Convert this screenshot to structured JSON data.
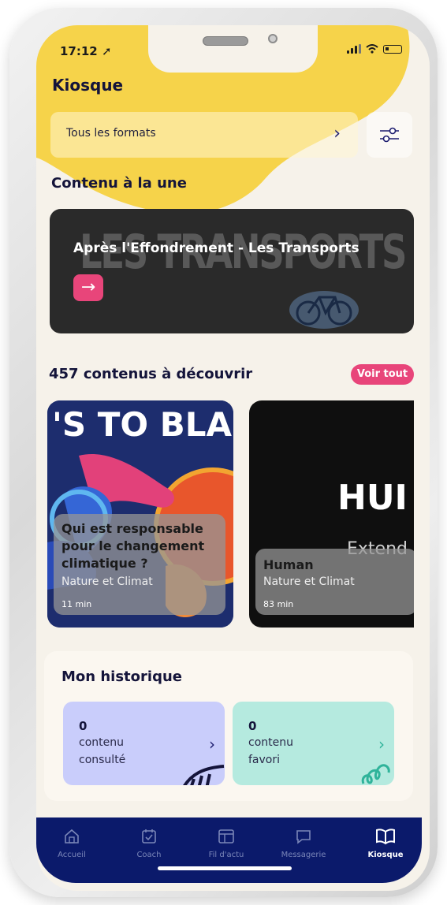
{
  "status_bar": {
    "time": "17:12"
  },
  "header": {
    "title": "Kiosque"
  },
  "format_filter": {
    "label": "Tous les formats"
  },
  "featured": {
    "section_title": "Contenu à la une",
    "card_background_text": "LES TRANSPORTS",
    "card_title": "Après l'Effondrement - Les Transports"
  },
  "discover": {
    "section_title": "457 contenus à découvrir",
    "see_all_label": "Voir tout",
    "cards": [
      {
        "image_text": "'S TO BLA",
        "title_lines": [
          "Qui est responsable",
          "pour le changement",
          "climatique ?"
        ],
        "category": "Nature et Climat",
        "duration": "11 min"
      },
      {
        "image_text": "HUI",
        "image_subtext": "Extend",
        "title_lines": [
          "Human"
        ],
        "category": "Nature et Climat",
        "duration": "83 min"
      }
    ]
  },
  "history": {
    "title": "Mon historique",
    "viewed": {
      "count": "0",
      "line1": "contenu",
      "line2": "consulté"
    },
    "favorites": {
      "count": "0",
      "line1": "contenu",
      "line2": "favori"
    }
  },
  "tab_bar": {
    "items": [
      {
        "label": "Accueil",
        "icon": "home-icon"
      },
      {
        "label": "Coach",
        "icon": "calendar-check-icon"
      },
      {
        "label": "Fil d'actu",
        "icon": "layout-icon"
      },
      {
        "label": "Messagerie",
        "icon": "chat-bubble-icon"
      },
      {
        "label": "Kiosque",
        "icon": "open-book-icon",
        "active": true
      }
    ]
  },
  "colors": {
    "accent_pink": "#e8457a",
    "brand_yellow": "#f6d34a",
    "tab_bar_navy": "#0b1a6b",
    "tile_lavender": "#c9cdfb",
    "tile_mint": "#b5eadf"
  }
}
